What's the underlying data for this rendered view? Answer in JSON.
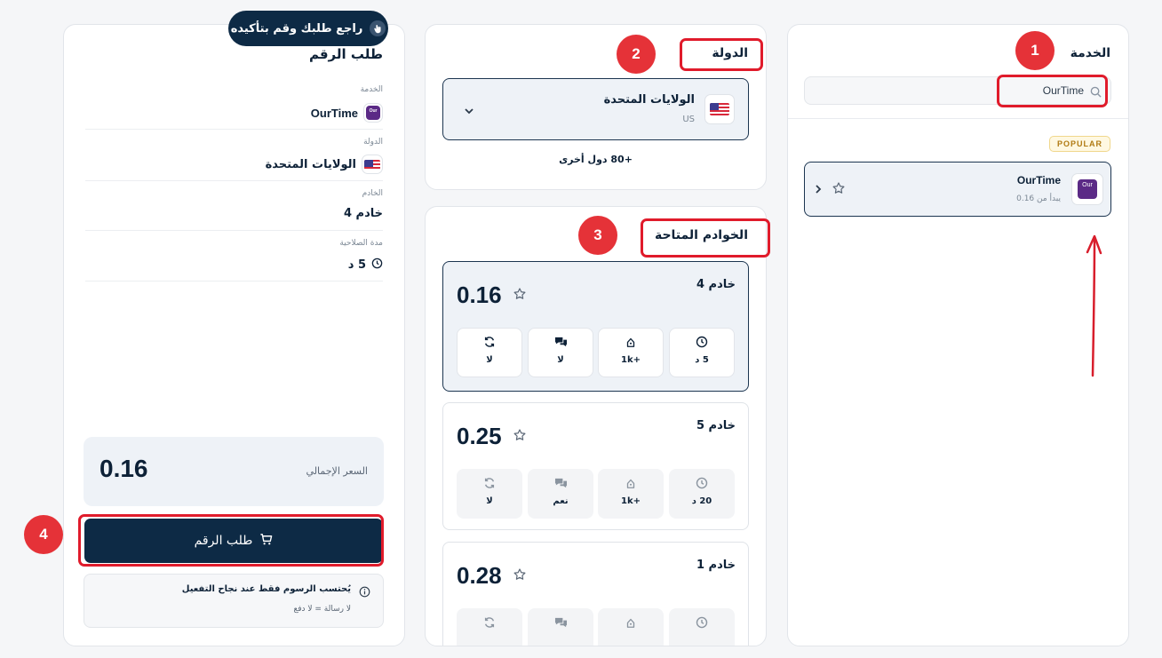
{
  "service_panel": {
    "title": "الخدمة",
    "search_value": "OurTime",
    "popular_badge": "POPULAR",
    "service": {
      "name": "OurTime",
      "subtitle": "يبدأ من 0.16",
      "logo_text": "Our"
    }
  },
  "country_panel": {
    "title": "الدولة",
    "selected_name": "الولايات المتحدة",
    "selected_code": "US",
    "more_countries": "+80 دول أخرى"
  },
  "servers_panel": {
    "title": "الخوادم المتاحة",
    "servers": [
      {
        "name": "خادم 4",
        "price": "0.16",
        "time": "5 د",
        "stock": "1k+",
        "multi_sms": "لا",
        "renew": "لا",
        "selected": true
      },
      {
        "name": "خادم 5",
        "price": "0.25",
        "time": "20 د",
        "stock": "1k+",
        "multi_sms": "نعم",
        "renew": "لا",
        "selected": false
      },
      {
        "name": "خادم 1",
        "price": "0.28",
        "time": "",
        "stock": "",
        "multi_sms": "",
        "renew": "",
        "selected": false
      }
    ]
  },
  "order_panel": {
    "title": "طلب الرقم",
    "tooltip": "راجع طلبك وقم بتأكيده",
    "service_label": "الخدمة",
    "service_value": "OurTime",
    "country_label": "الدولة",
    "country_value": "الولايات المتحدة",
    "server_label": "الخادم",
    "server_value": "خادم 4",
    "validity_label": "مدة الصلاحية",
    "validity_value": "5 د",
    "total_label": "السعر الإجمالي",
    "total_value": "0.16",
    "order_button": "طلب الرقم",
    "note_title": "يُحتسب الرسوم فقط عند نجاح التفعيل",
    "note_sub": "لا رسالة = لا دفع"
  },
  "annotations": {
    "step1": "1",
    "step2": "2",
    "step3": "3",
    "step4": "4",
    "arrow_color": "#d81e2c"
  },
  "colors": {
    "primary": "#0d2a45",
    "highlight": "#e01b2b",
    "selected_bg": "#eef2f7"
  }
}
